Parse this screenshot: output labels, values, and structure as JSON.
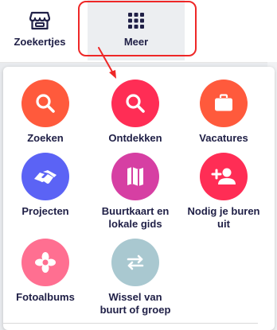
{
  "tabs": {
    "zoekertjes": {
      "label": "Zoekertjes",
      "icon": "storefront-icon"
    },
    "meer": {
      "label": "Meer",
      "icon": "grid-icon"
    }
  },
  "menu": {
    "items": [
      {
        "label": "Zoeken",
        "icon": "search-icon",
        "color": "#ff5a3c"
      },
      {
        "label": "Ontdekken",
        "icon": "search-icon",
        "color": "#ff2d55"
      },
      {
        "label": "Vacatures",
        "icon": "briefcase-icon",
        "color": "#ff5a3c"
      },
      {
        "label": "Projecten",
        "icon": "handshake-icon",
        "color": "#5b63f5"
      },
      {
        "label": "Buurtkaart en\nlokale gids",
        "icon": "map-icon",
        "color": "#d63fa3"
      },
      {
        "label": "Nodig je buren\nuit",
        "icon": "add-person-icon",
        "color": "#ff2d55"
      },
      {
        "label": "Fotoalbums",
        "icon": "flower-icon",
        "color": "#ff6f91"
      },
      {
        "label": "Wissel van\nbuurt of groep",
        "icon": "swap-arrows-icon",
        "color": "#a9c8d0"
      }
    ]
  },
  "colors": {
    "text": "#202047",
    "highlight": "#ee2727",
    "active_tab_bg": "#eceef1"
  }
}
